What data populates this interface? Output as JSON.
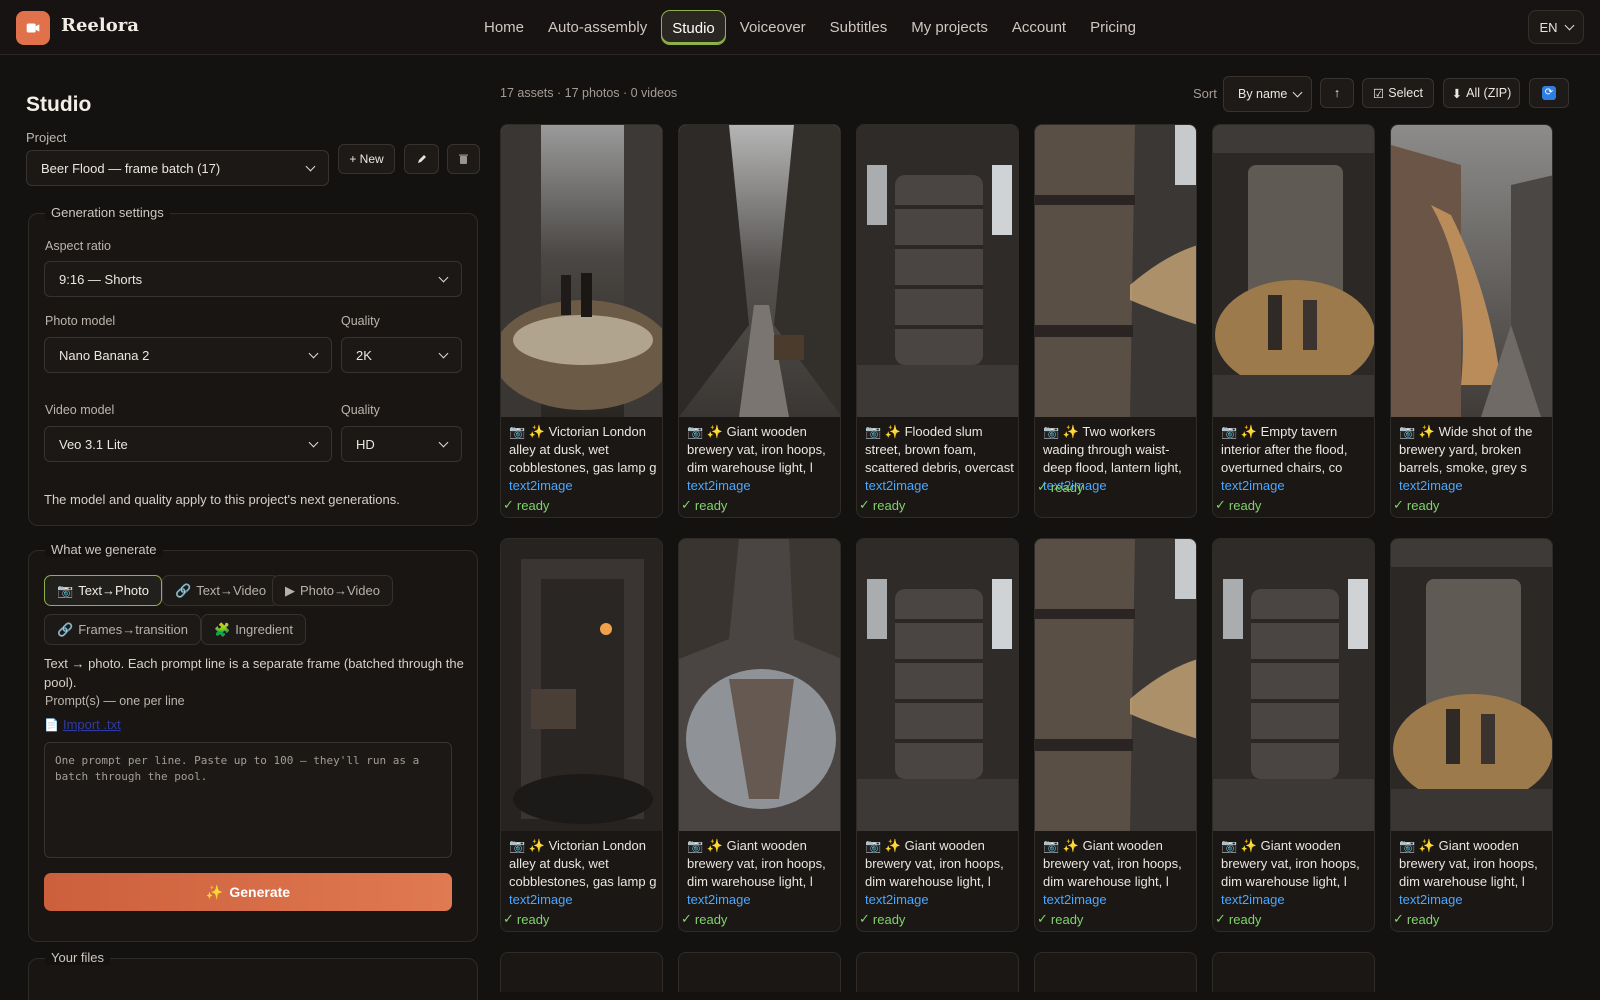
{
  "app": {
    "name": "Reelora",
    "language": "EN"
  },
  "nav": {
    "items": [
      {
        "label": "Home"
      },
      {
        "label": "Auto-assembly"
      },
      {
        "label": "Studio",
        "active": true
      },
      {
        "label": "Voiceover"
      },
      {
        "label": "Subtitles"
      },
      {
        "label": "My projects"
      },
      {
        "label": "Account"
      },
      {
        "label": "Pricing"
      }
    ]
  },
  "sidebar": {
    "title": "Studio",
    "project_label": "Project",
    "project_value": "Beer Flood — frame batch (17)",
    "new_button": "+ New",
    "generation": {
      "legend": "Generation settings",
      "aspect_label": "Aspect ratio",
      "aspect_value": "9:16 — Shorts",
      "photo_model_label": "Photo model",
      "photo_model_value": "Nano Banana 2",
      "photo_quality_label": "Quality",
      "photo_quality_value": "2K",
      "video_model_label": "Video model",
      "video_model_value": "Veo 3.1 Lite",
      "video_quality_label": "Quality",
      "video_quality_value": "HD",
      "note": "The model and quality apply to this project's next generations."
    },
    "what": {
      "legend": "What we generate",
      "modes": [
        "Text→Photo",
        "Text→Video",
        "Photo→Video",
        "Frames→transition",
        "Ingredient"
      ],
      "description": "Text → photo. Each prompt line is a separate frame (batched through the pool).",
      "prompts_label": "Prompt(s) — one per line",
      "import_link": "Import .txt",
      "prompt_placeholder": "One prompt per line. Paste up to 100 — they'll run as a batch through the pool.",
      "generate_button": "Generate"
    },
    "files_legend": "Your files"
  },
  "toolbar": {
    "counts": "17 assets · 17 photos · 0 videos",
    "sort_label": "Sort",
    "sort_value": "By name",
    "select_button": "Select",
    "zip_button": "All (ZIP)"
  },
  "assets": [
    {
      "caption": "📷 ✨ Victorian London alley at dusk, wet cobblestones, gas lamp g",
      "tag": "text2image",
      "status": "ready"
    },
    {
      "caption": "📷 ✨ Giant wooden brewery vat, iron hoops, dim warehouse light, l",
      "tag": "text2image",
      "status": "ready"
    },
    {
      "caption": "📷 ✨ Flooded slum street, brown foam, scattered debris, overcast",
      "tag": "text2image",
      "status": "ready"
    },
    {
      "caption": "📷 ✨ Two workers wading through waist-deep flood, lantern light,",
      "tag": "text2image",
      "status": "ready"
    },
    {
      "caption": "📷 ✨ Empty tavern interior after the flood, overturned chairs, co",
      "tag": "text2image",
      "status": "ready"
    },
    {
      "caption": "📷 ✨ Wide shot of the brewery yard, broken barrels, smoke, grey s",
      "tag": "text2image",
      "status": "ready"
    },
    {
      "caption": "📷 ✨ Victorian London alley at dusk, wet cobblestones, gas lamp g",
      "tag": "text2image",
      "status": "ready"
    },
    {
      "caption": "📷 ✨ Giant wooden brewery vat, iron hoops, dim warehouse light, l",
      "tag": "text2image",
      "status": "ready"
    },
    {
      "caption": "📷 ✨ Giant wooden brewery vat, iron hoops, dim warehouse light, l",
      "tag": "text2image",
      "status": "ready"
    },
    {
      "caption": "📷 ✨ Giant wooden brewery vat, iron hoops, dim warehouse light, l",
      "tag": "text2image",
      "status": "ready"
    },
    {
      "caption": "📷 ✨ Giant wooden brewery vat, iron hoops, dim warehouse light, l",
      "tag": "text2image",
      "status": "ready"
    },
    {
      "caption": "📷 ✨ Giant wooden brewery vat, iron hoops, dim warehouse light, l",
      "tag": "text2image",
      "status": "ready"
    }
  ]
}
